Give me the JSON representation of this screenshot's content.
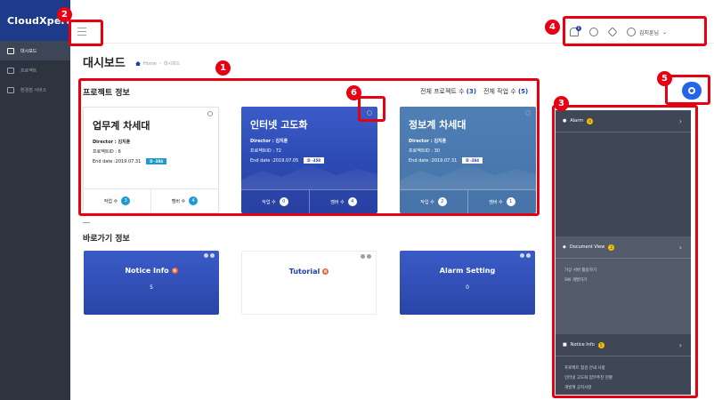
{
  "app": {
    "logo": "CloudXpert"
  },
  "sidebar": {
    "items": [
      {
        "label": "대시보드",
        "active": true
      },
      {
        "label": "프로젝트",
        "active": false
      },
      {
        "label": "환경점 서비스",
        "active": false
      }
    ]
  },
  "topbar": {
    "bell_badge": "0",
    "user_name": "김지훈님"
  },
  "page": {
    "title": "대시보드",
    "breadcrumb": [
      "Home",
      "대시보드"
    ]
  },
  "project_section": {
    "title": "프로젝트 정보",
    "total_projects_label": "전체 프로젝트 수",
    "total_projects_value": "(3)",
    "total_tasks_label": "전체 작업 수",
    "total_tasks_value": "(5)",
    "cards": [
      {
        "title": "업무계 차세대",
        "director": "Director : 김지훈",
        "project_id": "프로젝트ID : 6",
        "end_date": "End date :2019.07.31",
        "dday": "D -384",
        "task_label": "작업 수",
        "task_count": "3",
        "member_label": "멤버 수",
        "member_count": "4"
      },
      {
        "title": "인터넷 고도화",
        "director": "Director : 김지훈",
        "project_id": "프로젝트ID : 72",
        "end_date": "End date :2019.07.05",
        "dday": "D -358",
        "task_label": "작업 수",
        "task_count": "0",
        "member_label": "멤버 수",
        "member_count": "4"
      },
      {
        "title": "정보계 차세대",
        "director": "Director : 김지훈",
        "project_id": "프로젝트ID : 30",
        "end_date": "End date :2019.07.31",
        "dday": "D -384",
        "task_label": "작업 수",
        "task_count": "2",
        "member_label": "멤버 수",
        "member_count": "1"
      }
    ]
  },
  "shortcut_section": {
    "title": "바로가기 정보",
    "cards": [
      {
        "title": "Notice Info",
        "badge": "N",
        "value": "5"
      },
      {
        "title": "Tutorial",
        "badge": "N",
        "value": ""
      },
      {
        "title": "Alarm Setting",
        "badge": "N",
        "value": "0"
      }
    ]
  },
  "right_panel": {
    "alarm": {
      "label": "Alarm",
      "count": "0"
    },
    "document_view": {
      "label": "Document View",
      "count": "2",
      "items": [
        "가상 서버 활용하기",
        "SW 개발하기"
      ]
    },
    "notice_info": {
      "label": "Notice Info",
      "count": "5",
      "items": [
        "프로젝트 점검 안내 사항",
        "인터넷 고도화 업무추진 현황",
        "개발계 공지사항"
      ]
    }
  },
  "annotations": [
    "1",
    "2",
    "3",
    "4",
    "5",
    "6"
  ],
  "colors": {
    "annotation": "#e60012",
    "primary": "#1e40af",
    "sidebar": "#2d3440",
    "panel": "#3f4655"
  }
}
